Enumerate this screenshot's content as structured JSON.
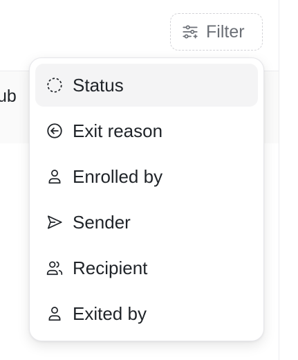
{
  "background": {
    "partial_text": "ub"
  },
  "filter_button": {
    "label": "Filter",
    "icon": "sliders-icon"
  },
  "menu": {
    "items": [
      {
        "label": "Status",
        "icon": "dashed-circle-icon",
        "active": true
      },
      {
        "label": "Exit reason",
        "icon": "circle-arrow-left-icon",
        "active": false
      },
      {
        "label": "Enrolled by",
        "icon": "user-icon",
        "active": false
      },
      {
        "label": "Sender",
        "icon": "send-icon",
        "active": false
      },
      {
        "label": "Recipient",
        "icon": "users-icon",
        "active": false
      },
      {
        "label": "Exited by",
        "icon": "user-icon",
        "active": false
      }
    ]
  },
  "colors": {
    "text": "#1f2328",
    "muted": "#6b6f76",
    "border": "#e6e6ea",
    "active_bg": "#f4f4f5"
  }
}
